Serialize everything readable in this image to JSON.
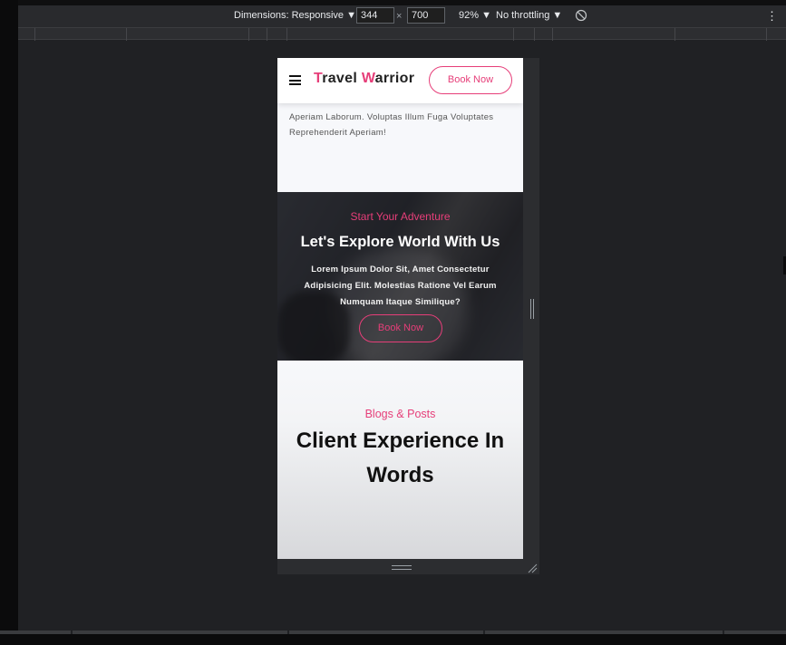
{
  "devtools": {
    "dimensions_label": "Dimensions: Responsive ▼",
    "width_value": "344",
    "times": "×",
    "height_value": "700",
    "zoom_label": "92% ▼",
    "throttle_label": "No throttling ▼",
    "more_icon": "⋮"
  },
  "site": {
    "logo_first_letter": "T",
    "logo_rest_1": "ravel ",
    "logo_second_letter": "W",
    "logo_rest_2": "arrior",
    "header_button": "Book Now",
    "intro_text": "Aperiam Laborum. Voluptas Illum Fuga Voluptates Reprehenderit Aperiam!",
    "hero": {
      "subtitle": "Start Your Adventure",
      "title": "Let's Explore World With Us",
      "description": "Lorem Ipsum Dolor Sit, Amet Consectetur Adipisicing Elit. Molestias Ratione Vel Earum Numquam Itaque Similique?",
      "button": "Book Now"
    },
    "blogs": {
      "subtitle": "Blogs & Posts",
      "title": "Client Experience In Words"
    }
  },
  "colors": {
    "accent": "#e63e79",
    "devtools_bg": "#202124",
    "toolbar_bg": "#292a2d"
  }
}
